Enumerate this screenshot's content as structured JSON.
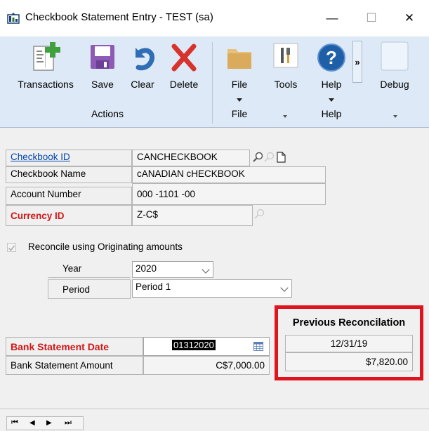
{
  "window": {
    "title": "Checkbook Statement Entry  -  TEST (sa)",
    "minimize_glyph": "—",
    "maximize_glyph": "☐",
    "close_glyph": "✕"
  },
  "ribbon": {
    "transactions_label": "Transactions",
    "save_label": "Save",
    "clear_label": "Clear",
    "delete_label": "Delete",
    "file_label": "File",
    "tools_label": "Tools",
    "help_label": "Help",
    "more_glyph": "»",
    "debug_label": "Debug",
    "groups": {
      "actions": "Actions",
      "file": "File",
      "help": "Help"
    }
  },
  "form": {
    "checkbook_id_label": "Checkbook ID",
    "checkbook_id_value": "CANCHECKBOOK",
    "checkbook_name_label": "Checkbook Name",
    "checkbook_name_value": "cANADIAN cHECKBOOK",
    "account_number_label": "Account Number",
    "account_number_value": "000 -1101 -00",
    "currency_id_label": "Currency ID",
    "currency_id_value": "Z-C$",
    "reconcile_label": "Reconcile using Originating amounts",
    "reconcile_checked": true,
    "year_label": "Year",
    "year_value": "2020",
    "period_label": "Period",
    "period_value": "Period 1",
    "bank_statement_date_label": "Bank Statement Date",
    "bank_statement_date_value": "01312020",
    "bank_statement_amount_label": "Bank Statement Amount",
    "bank_statement_amount_value": "C$7,000.00"
  },
  "previous_reconciliation": {
    "title": "Previous Reconcilation",
    "date": "12/31/19",
    "amount": "$7,820.00"
  },
  "nav": {
    "first": "⏮",
    "prev": "◀",
    "next": "▶",
    "last": "⏭"
  },
  "colors": {
    "ribbon_bg": "#dde9f6",
    "required_label": "#d11616",
    "highlight_box": "#e0141e",
    "link": "#0645ad"
  }
}
